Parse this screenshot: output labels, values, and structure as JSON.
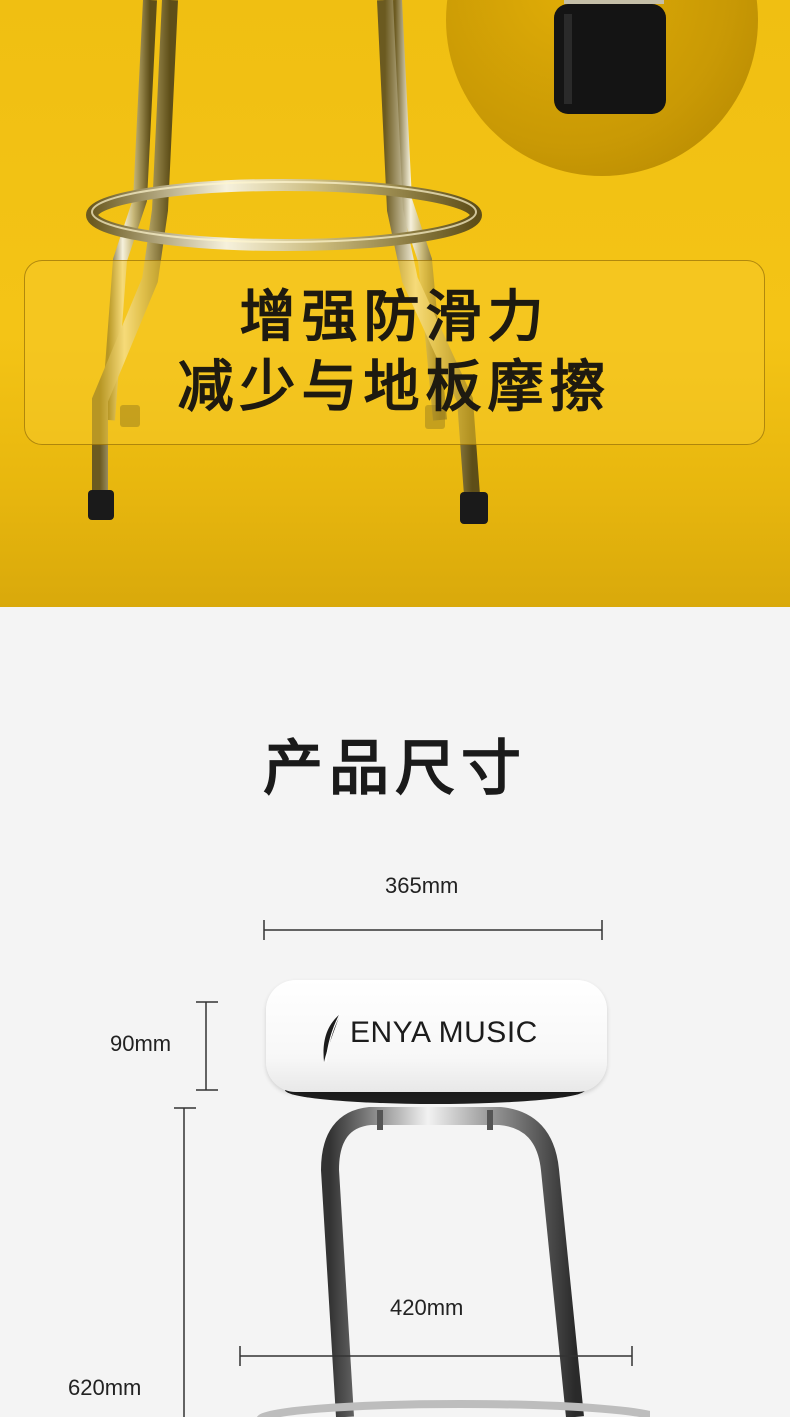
{
  "hero": {
    "headline_line1": "增强防滑力",
    "headline_line2": "减少与地板摩擦"
  },
  "dimensions_section": {
    "title": "产品尺寸",
    "seat_width": "365mm",
    "seat_thickness": "90mm",
    "base_width": "420mm",
    "height": "620mm",
    "brand": "ENYA MUSIC"
  },
  "colors": {
    "hero_background": "#f4c416",
    "banner_text": "#1e1a10",
    "page_background": "#f4f4f4"
  }
}
